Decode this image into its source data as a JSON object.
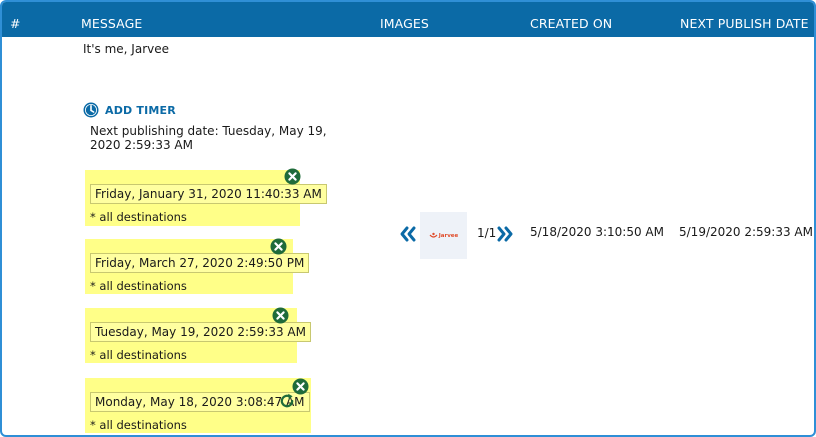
{
  "header": {
    "num": "#",
    "message": "MESSAGE",
    "images": "IMAGES",
    "created_on": "CREATED ON",
    "next_publish_date": "NEXT PUBLISH DATE"
  },
  "row": {
    "message": "It's me, Jarvee",
    "add_timer_label": "ADD TIMER",
    "next_publishing_label": "Next publishing date:  Tuesday, May 19, 2020 2:59:33 AM",
    "timers": [
      {
        "date": "Friday, January 31, 2020 11:40:33 AM",
        "destinations": "* all destinations"
      },
      {
        "date": "Friday, March 27, 2020 2:49:50 PM",
        "destinations": "* all destinations"
      },
      {
        "date": "Tuesday, May 19, 2020 2:59:33 AM",
        "destinations": "* all destinations"
      },
      {
        "date": "Monday, May 18, 2020 3:08:47 AM",
        "destinations": "* all destinations"
      }
    ],
    "image_counter": "1/1",
    "image_logo_text": "Jarvee",
    "created_on": "5/18/2020 3:10:50 AM",
    "next_publish_date": "5/19/2020 2:59:33 AM"
  },
  "icons": {
    "add_timer": "clock-icon",
    "remove_timer": "close-icon",
    "repeat_timer": "refresh-icon",
    "prev_image": "double-chevron-left-icon",
    "next_image": "double-chevron-right-icon"
  },
  "colors": {
    "header_bg": "#0b6aa6",
    "accent": "#0b6aa6",
    "timer_highlight": "#ffff88",
    "icon_green": "#1f6b3a",
    "frame_border": "#2f8fd6"
  }
}
